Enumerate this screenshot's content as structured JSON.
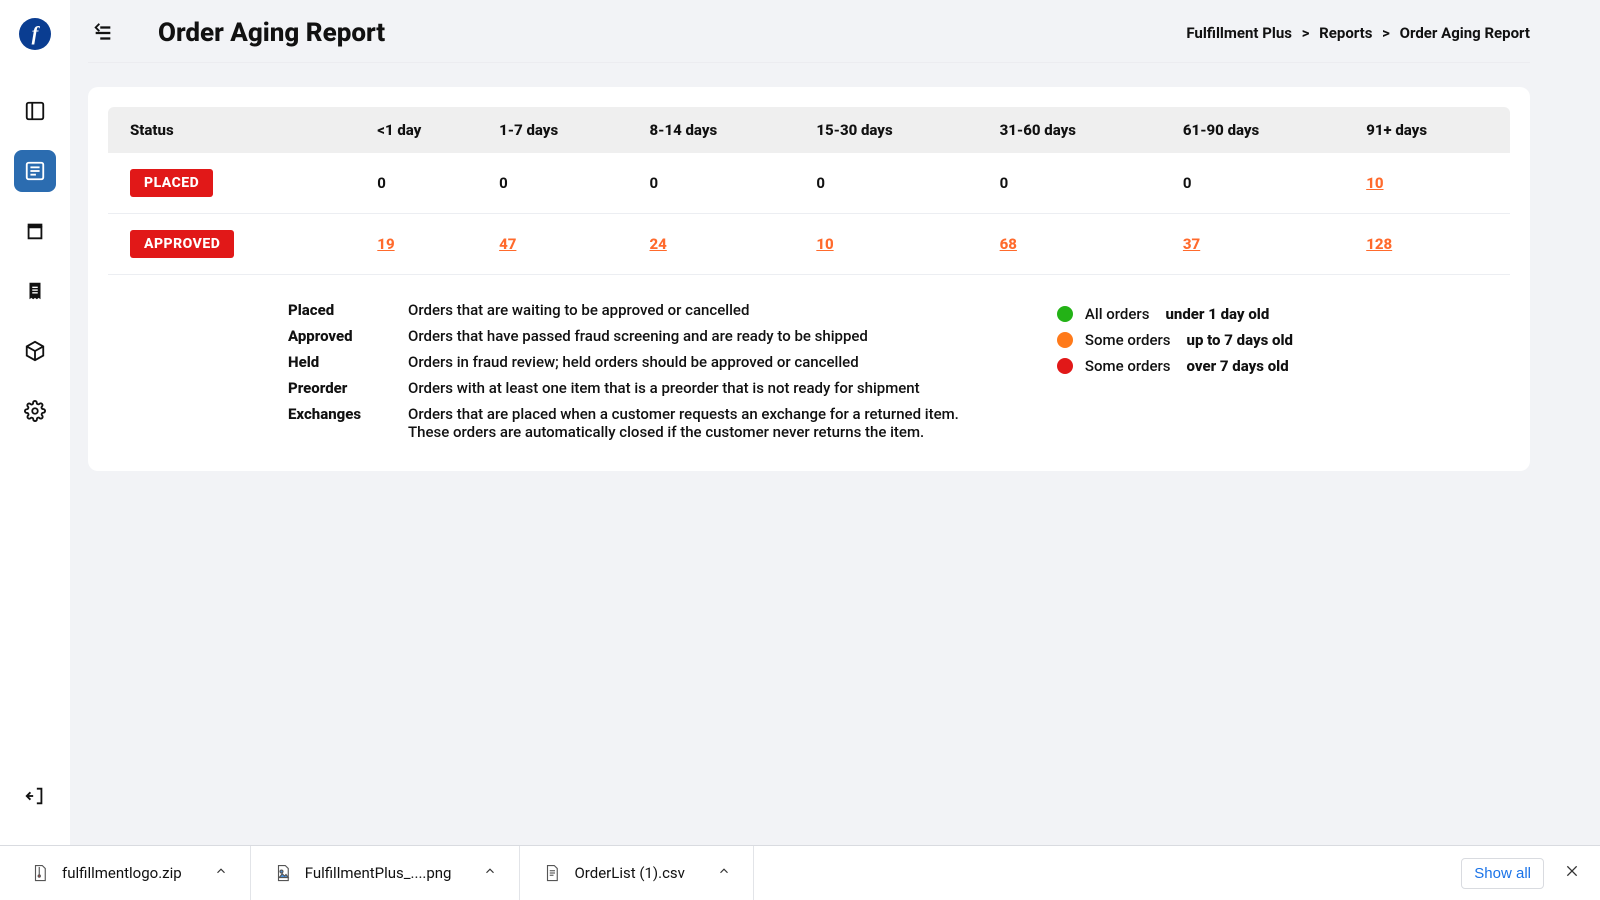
{
  "app": {
    "logo_letter": "f"
  },
  "header": {
    "title": "Order Aging Report",
    "breadcrumbs": [
      "Fulfillment Plus",
      "Reports",
      "Order Aging Report"
    ]
  },
  "table": {
    "columns": [
      "Status",
      "<1 day",
      "1-7 days",
      "8-14 days",
      "15-30 days",
      "31-60 days",
      "61-90 days",
      "91+ days"
    ],
    "rows": [
      {
        "status": "PLACED",
        "cells": [
          {
            "v": "0",
            "link": false
          },
          {
            "v": "0",
            "link": false
          },
          {
            "v": "0",
            "link": false
          },
          {
            "v": "0",
            "link": false
          },
          {
            "v": "0",
            "link": false
          },
          {
            "v": "0",
            "link": false
          },
          {
            "v": "10",
            "link": true
          }
        ]
      },
      {
        "status": "APPROVED",
        "cells": [
          {
            "v": "19",
            "link": true
          },
          {
            "v": "47",
            "link": true
          },
          {
            "v": "24",
            "link": true
          },
          {
            "v": "10",
            "link": true
          },
          {
            "v": "68",
            "link": true
          },
          {
            "v": "37",
            "link": true
          },
          {
            "v": "128",
            "link": true
          }
        ]
      }
    ]
  },
  "definitions": [
    {
      "term": "Placed",
      "desc": "Orders that are waiting to be approved or cancelled"
    },
    {
      "term": "Approved",
      "desc": "Orders that have passed fraud screening and are ready to be shipped"
    },
    {
      "term": "Held",
      "desc": "Orders in fraud review; held orders should be approved or cancelled"
    },
    {
      "term": "Preorder",
      "desc": "Orders with at least one item that is a preorder that is not ready for shipment"
    },
    {
      "term": "Exchanges",
      "desc": "Orders that are placed when a customer requests an exchange for a returned item. These orders are automatically closed if the customer never returns the item."
    }
  ],
  "legend": [
    {
      "color": "#23b216",
      "text": "All orders",
      "bold": "under 1 day old"
    },
    {
      "color": "#ff7a1a",
      "text": "Some orders",
      "bold": "up to 7 days old"
    },
    {
      "color": "#e11818",
      "text": "Some orders",
      "bold": "over 7 days old"
    }
  ],
  "downloads": {
    "items": [
      {
        "name": "fulfillmentlogo.zip",
        "type": "zip"
      },
      {
        "name": "FulfillmentPlus_....png",
        "type": "png"
      },
      {
        "name": "OrderList (1).csv",
        "type": "csv"
      }
    ],
    "show_all": "Show all"
  }
}
